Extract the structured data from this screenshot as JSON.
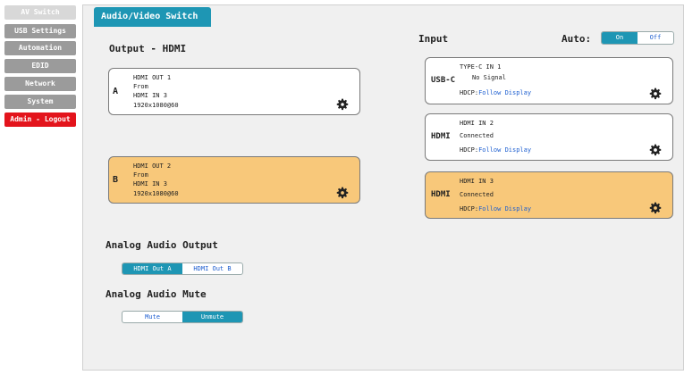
{
  "sidebar": {
    "items": [
      {
        "label": "AV Switch"
      },
      {
        "label": "USB Settings"
      },
      {
        "label": "Automation"
      },
      {
        "label": "EDID"
      },
      {
        "label": "Network"
      },
      {
        "label": "System"
      },
      {
        "label": "Admin - Logout"
      }
    ],
    "active_index": 0
  },
  "page": {
    "title": "Audio/Video Switch"
  },
  "output": {
    "heading": "Output - HDMI",
    "boxes": [
      {
        "letter": "A",
        "name": "HDMI OUT 1",
        "from_label": "From",
        "source": "HDMI IN 3",
        "resolution": "1920x1080@60",
        "selected": false
      },
      {
        "letter": "B",
        "name": "HDMI OUT 2",
        "from_label": "From",
        "source": "HDMI IN 3",
        "resolution": "1920x1080@60",
        "selected": true
      }
    ]
  },
  "input": {
    "heading": "Input",
    "auto_label": "Auto:",
    "auto_options": [
      "On",
      "Off"
    ],
    "auto_selected": "On",
    "boxes": [
      {
        "type": "USB-C",
        "name": "TYPE-C IN 1",
        "status": "No Signal",
        "hdcp_label": "HDCP:",
        "hdcp_value": "Follow Display",
        "selected": false
      },
      {
        "type": "HDMI",
        "name": "HDMI IN 2",
        "status": "Connected",
        "hdcp_label": "HDCP:",
        "hdcp_value": "Follow Display",
        "selected": false
      },
      {
        "type": "HDMI",
        "name": "HDMI IN 3",
        "status": "Connected",
        "hdcp_label": "HDCP:",
        "hdcp_value": "Follow Display",
        "selected": true
      }
    ]
  },
  "analog_audio_output": {
    "heading": "Analog Audio Output",
    "options": [
      "HDMI Out A",
      "HDMI Out B"
    ],
    "selected": "HDMI Out A"
  },
  "analog_audio_mute": {
    "heading": "Analog Audio Mute",
    "options": [
      "Mute",
      "Unmute"
    ],
    "selected": "Unmute"
  },
  "colors": {
    "accent": "#1e96b4",
    "selected_box": "#f8c87a",
    "logout": "#e3141c",
    "hdcp_text": "#1e5fd0"
  },
  "icons": {
    "settings": "gear-icon"
  }
}
